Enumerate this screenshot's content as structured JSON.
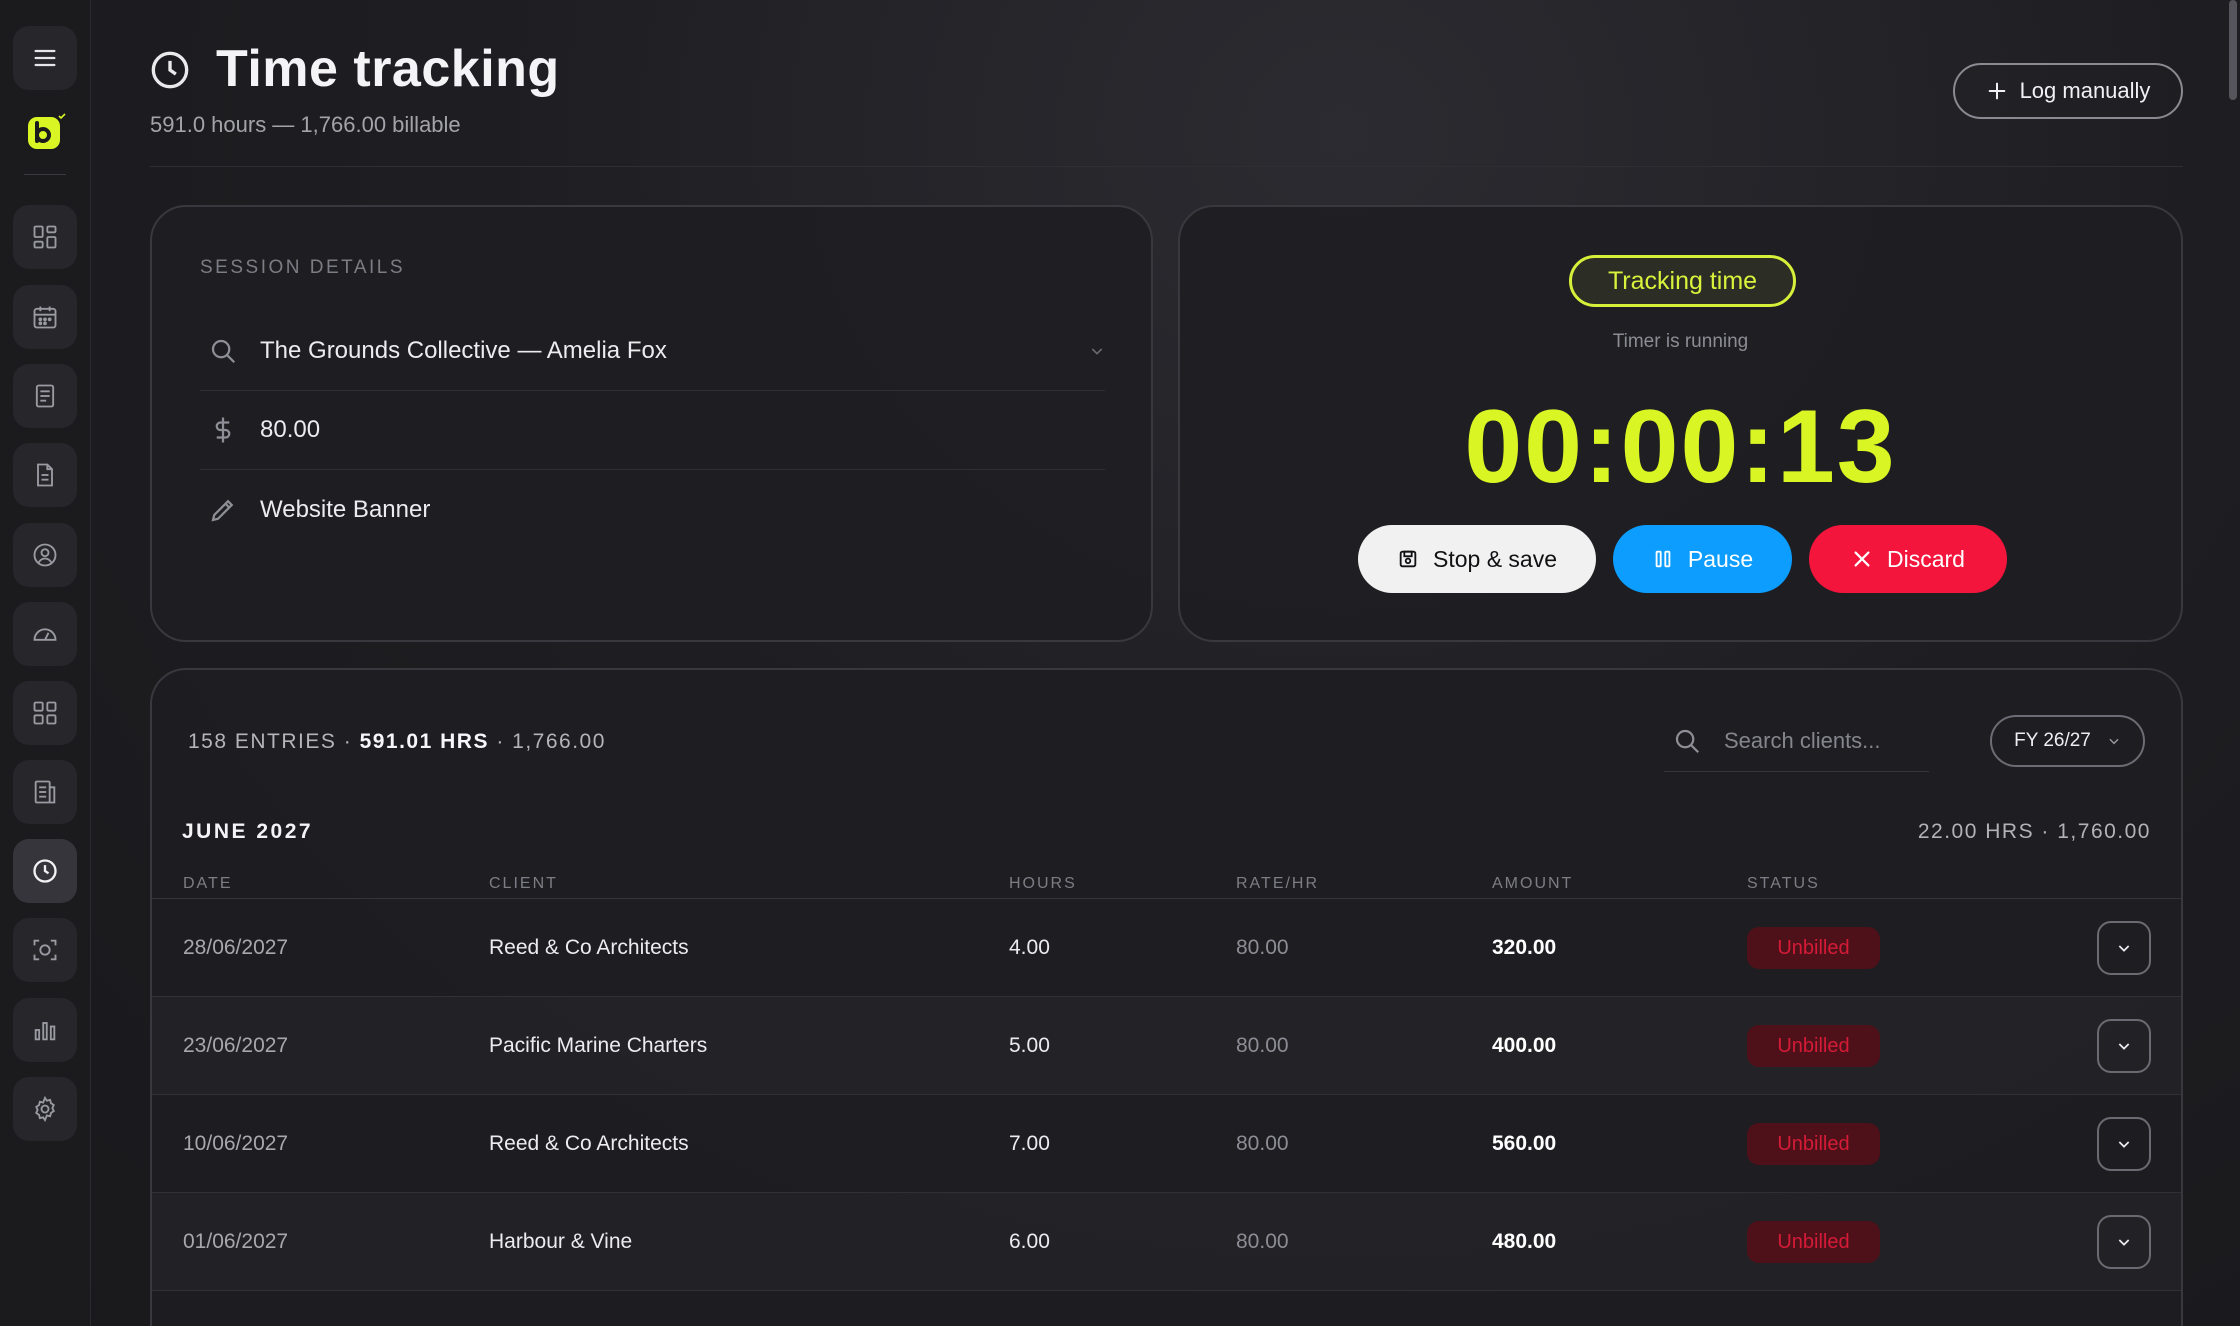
{
  "page": {
    "title": "Time tracking",
    "subtitle": "591.0 hours — 1,766.00 billable",
    "log_manually_label": "Log manually"
  },
  "sidebar": {
    "items": [
      {
        "icon": "menu-icon"
      },
      {
        "icon": "dashboard-icon"
      },
      {
        "icon": "calendar-icon"
      },
      {
        "icon": "invoice-icon"
      },
      {
        "icon": "document-icon"
      },
      {
        "icon": "user-circle-icon"
      },
      {
        "icon": "speedometer-icon"
      },
      {
        "icon": "grid-icon"
      },
      {
        "icon": "report-icon"
      },
      {
        "icon": "clock-icon",
        "active": true
      },
      {
        "icon": "scan-face-icon"
      },
      {
        "icon": "bar-chart-icon"
      },
      {
        "icon": "gear-icon"
      }
    ]
  },
  "session": {
    "section_label": "SESSION DETAILS",
    "client": "The Grounds Collective — Amelia Fox",
    "rate": "80.00",
    "description": "Website Banner"
  },
  "timer": {
    "badge": "Tracking time",
    "status": "Timer is running",
    "value": "00:00:13",
    "stop_label": "Stop & save",
    "pause_label": "Pause",
    "discard_label": "Discard"
  },
  "entries": {
    "count_text": "158 ENTRIES",
    "hours_text": "591.01 HRS",
    "amount_text": "1,766.00",
    "search_placeholder": "Search clients...",
    "fy_selected": "FY 26/27",
    "month": "JUNE 2027",
    "month_total": "22.00 HRS · 1,760.00",
    "columns": [
      "DATE",
      "CLIENT",
      "HOURS",
      "RATE/HR",
      "AMOUNT",
      "STATUS"
    ],
    "rows": [
      {
        "date": "28/06/2027",
        "client": "Reed & Co Architects",
        "hours": "4.00",
        "rate": "80.00",
        "amount": "320.00",
        "status": "Unbilled"
      },
      {
        "date": "23/06/2027",
        "client": "Pacific Marine Charters",
        "hours": "5.00",
        "rate": "80.00",
        "amount": "400.00",
        "status": "Unbilled"
      },
      {
        "date": "10/06/2027",
        "client": "Reed & Co Architects",
        "hours": "7.00",
        "rate": "80.00",
        "amount": "560.00",
        "status": "Unbilled"
      },
      {
        "date": "01/06/2027",
        "client": "Harbour & Vine",
        "hours": "6.00",
        "rate": "80.00",
        "amount": "480.00",
        "status": "Unbilled"
      }
    ]
  },
  "colors": {
    "accent": "#d9f523",
    "pause": "#0c9dff",
    "discard": "#f4153c",
    "unbilled_text": "#d51b37",
    "unbilled_bg": "#4e1119"
  }
}
